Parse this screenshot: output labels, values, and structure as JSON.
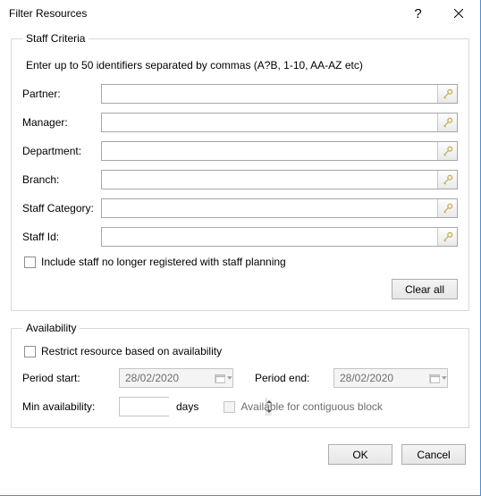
{
  "window": {
    "title": "Filter Resources"
  },
  "staff": {
    "legend": "Staff Criteria",
    "hint": "Enter up to 50 identifiers separated by commas (A?B, 1-10, AA-AZ etc)",
    "fields": {
      "partner": {
        "label": "Partner:",
        "value": ""
      },
      "manager": {
        "label": "Manager:",
        "value": ""
      },
      "department": {
        "label": "Department:",
        "value": ""
      },
      "branch": {
        "label": "Branch:",
        "value": ""
      },
      "staff_category": {
        "label": "Staff Category:",
        "value": ""
      },
      "staff_id": {
        "label": "Staff Id:",
        "value": ""
      }
    },
    "include_unregistered": "Include staff no longer registered with staff planning",
    "clear_all": "Clear all"
  },
  "availability": {
    "legend": "Availability",
    "restrict": "Restrict resource based on availability",
    "period_start_label": "Period start:",
    "period_start_value": "28/02/2020",
    "period_end_label": "Period end:",
    "period_end_value": "28/02/2020",
    "min_avail_label": "Min availability:",
    "min_avail_value": "",
    "days": "days",
    "contiguous": "Available for contiguous block"
  },
  "footer": {
    "ok": "OK",
    "cancel": "Cancel"
  }
}
